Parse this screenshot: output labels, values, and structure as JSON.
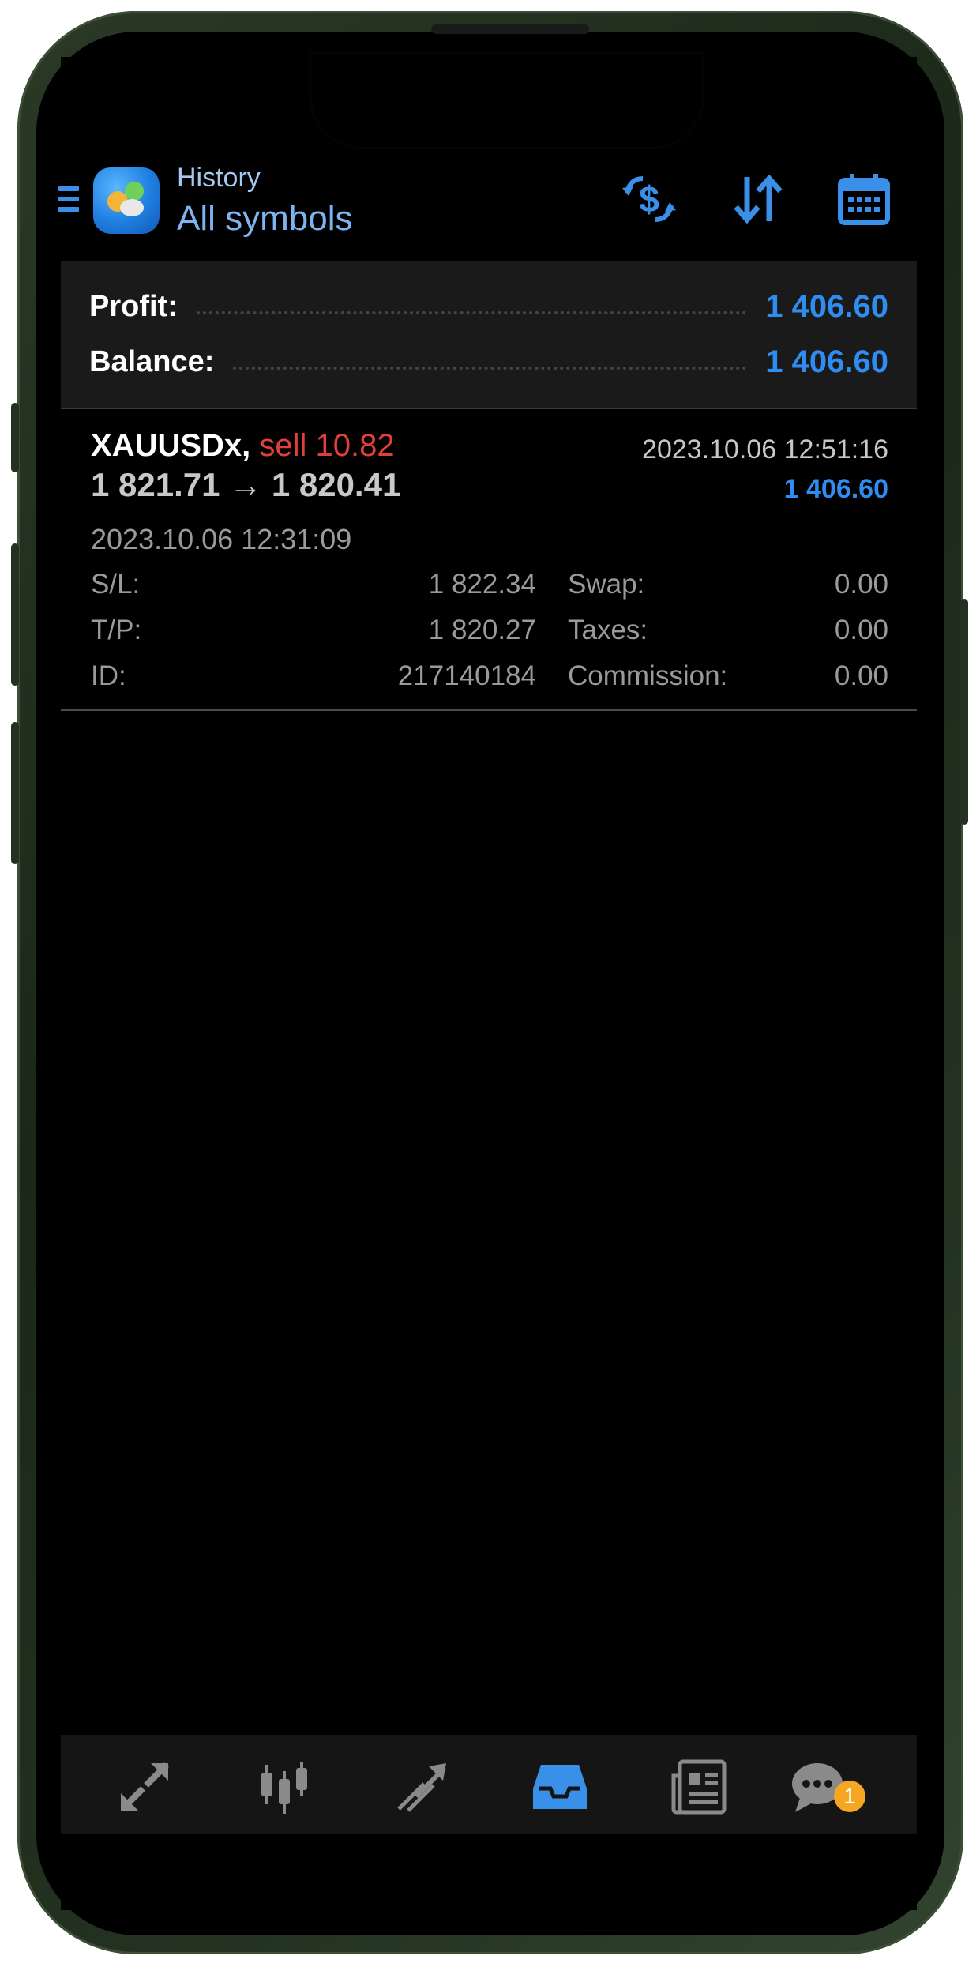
{
  "header": {
    "subtitle": "History",
    "title": "All symbols"
  },
  "summary": {
    "profit_label": "Profit:",
    "profit_value": "1 406.60",
    "balance_label": "Balance:",
    "balance_value": "1 406.60"
  },
  "trade": {
    "symbol": "XAUUSDx,",
    "side": "sell 10.82",
    "prices": "1 821.71 → 1 820.41",
    "close_time": "2023.10.06 12:51:16",
    "profit": "1 406.60",
    "open_time": "2023.10.06 12:31:09",
    "details": {
      "sl_label": "S/L:",
      "sl_value": "1 822.34",
      "tp_label": "T/P:",
      "tp_value": "1 820.27",
      "id_label": "ID:",
      "id_value": "217140184",
      "swap_label": "Swap:",
      "swap_value": "0.00",
      "taxes_label": "Taxes:",
      "taxes_value": "0.00",
      "commission_label": "Commission:",
      "commission_value": "0.00"
    }
  },
  "bottom_nav": {
    "items": [
      "quotes-icon",
      "chart-icon",
      "trade-icon",
      "history-icon",
      "news-icon",
      "messages-icon"
    ],
    "active": "history-icon",
    "messages_badge": "1"
  },
  "colors": {
    "accent": "#2f8cf0",
    "sell": "#e0403a",
    "badge": "#f5a623"
  }
}
